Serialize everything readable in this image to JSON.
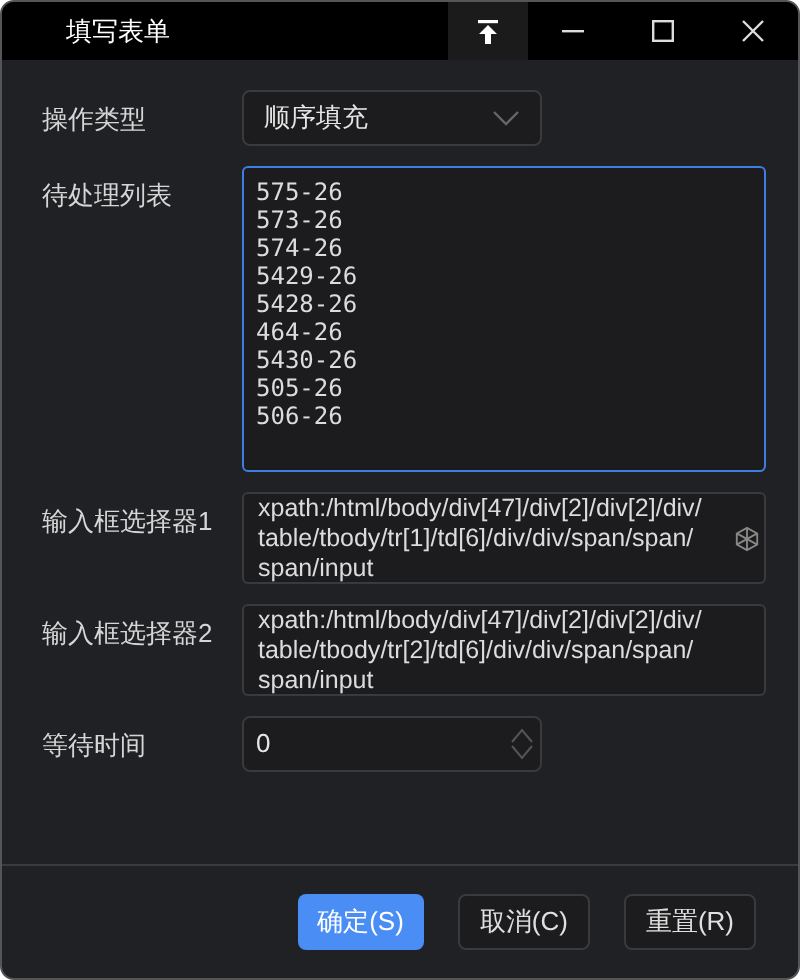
{
  "window": {
    "title": "填写表单",
    "pinned": true
  },
  "fields": [
    {
      "kind": "select",
      "label": "操作类型",
      "value": "顺序填充"
    },
    {
      "kind": "list",
      "label": "待处理列表",
      "focused": true,
      "lines": [
        "575-26",
        "573-26",
        "574-26",
        "5429-26",
        "5428-26",
        "464-26",
        "5430-26",
        "505-26",
        "506-26"
      ]
    },
    {
      "kind": "selector",
      "label": "输入框选择器1",
      "value": "xpath:/html/body/div[47]/div[2]/div[2]/div/table/tbody/tr[1]/td[6]/div/div/span/span/span/input",
      "picker": true
    },
    {
      "kind": "selector",
      "label": "输入框选择器2",
      "value": "xpath:/html/body/div[47]/div[2]/div[2]/div/table/tbody/tr[2]/td[6]/div/div/span/span/span/input",
      "picker": false
    },
    {
      "kind": "number",
      "label": "等待时间",
      "value": "0"
    }
  ],
  "buttons": [
    {
      "label": "确定(S)",
      "primary": true
    },
    {
      "label": "取消(C)",
      "primary": false
    },
    {
      "label": "重置(R)",
      "primary": false
    }
  ]
}
